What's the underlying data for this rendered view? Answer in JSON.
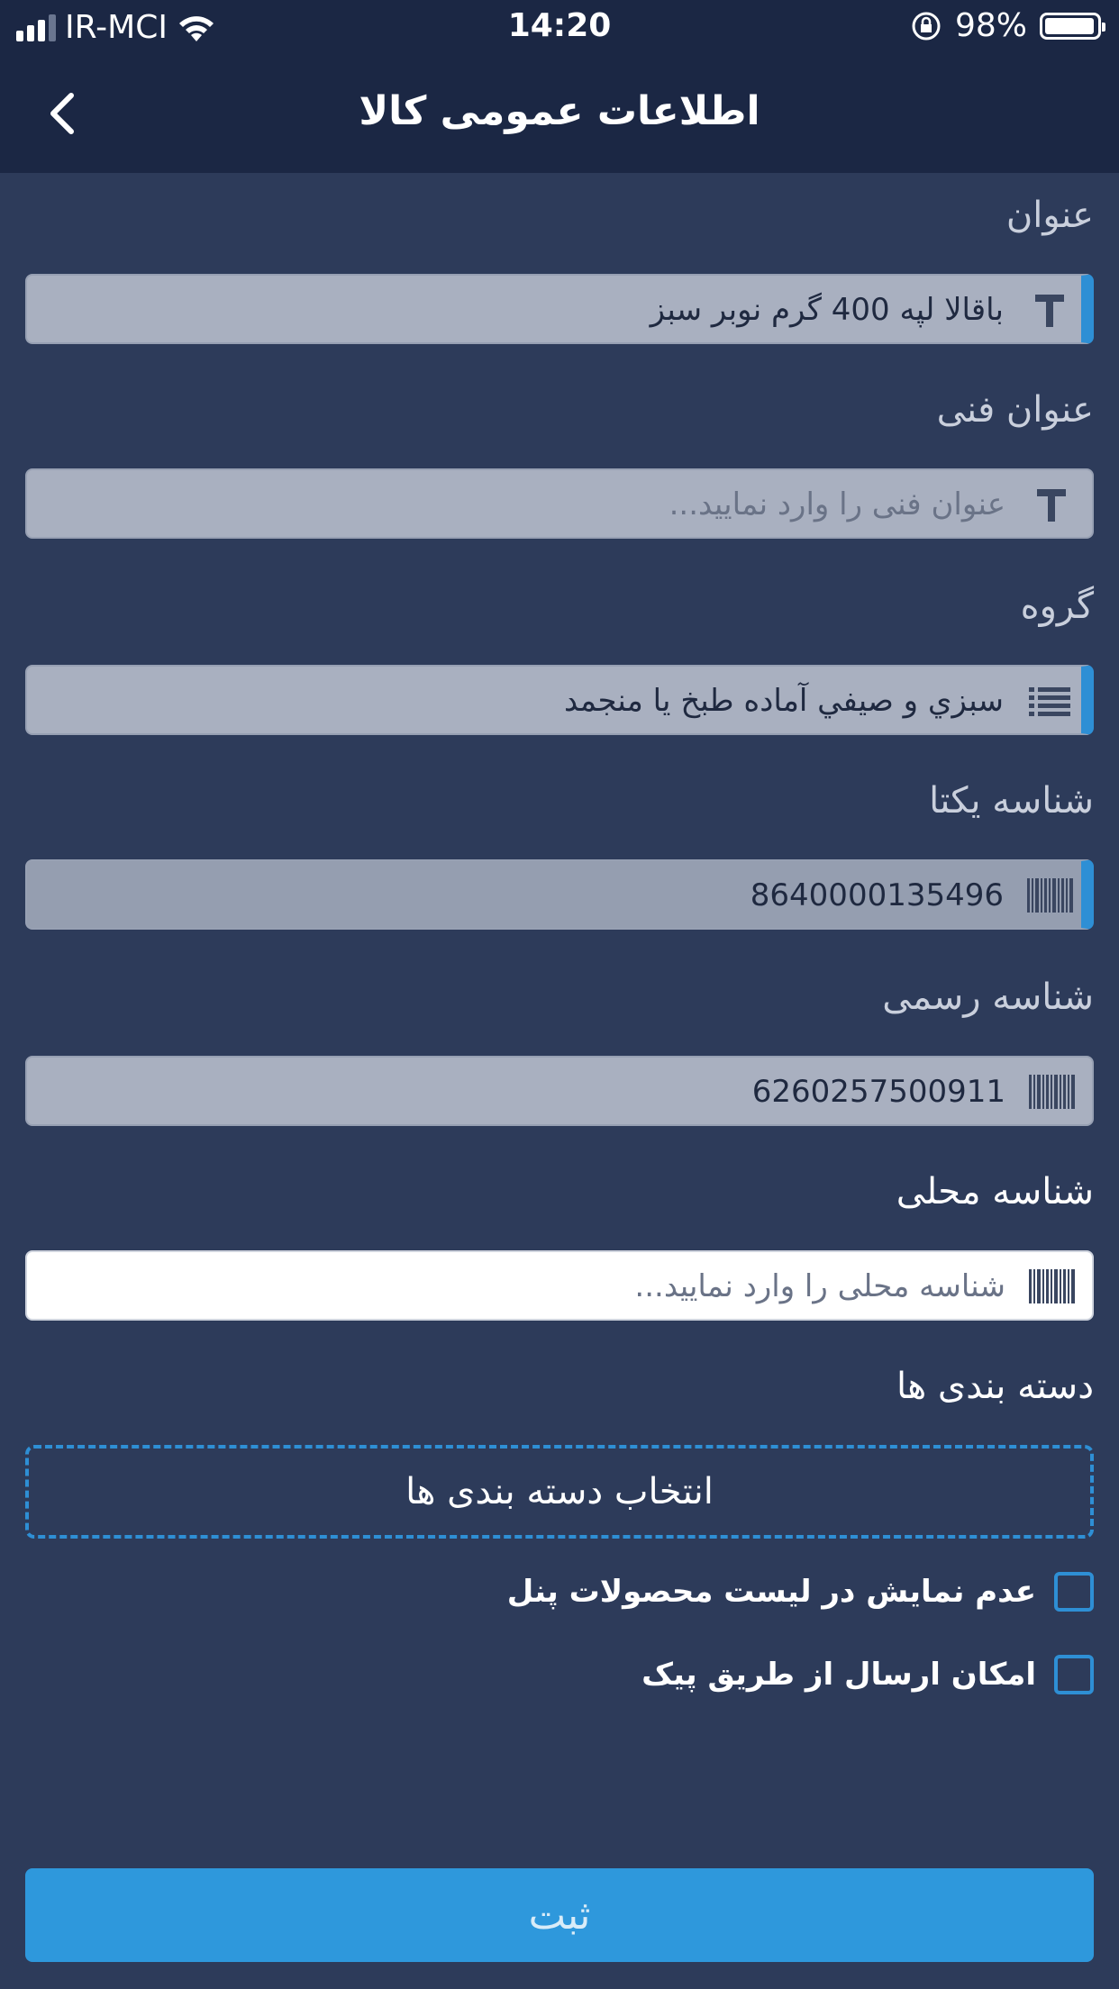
{
  "status_bar": {
    "carrier": "IR-MCI",
    "time": "14:20",
    "battery": "98%",
    "battery_level": 0.98
  },
  "nav": {
    "title": "اطلاعات عمومی کالا",
    "back_icon": "chevron-left-icon"
  },
  "fields": {
    "title": {
      "label": "عنوان",
      "value": "باقالا لپه 400 گرم نوبر سبز",
      "icon": "text-icon"
    },
    "technical_title": {
      "label": "عنوان فنی",
      "placeholder": "عنوان فنی را وارد نمایید...",
      "icon": "text-icon"
    },
    "group": {
      "label": "گروه",
      "value": "سبزي و صيفي آماده طبخ يا منجمد",
      "icon": "list-icon"
    },
    "unique_id": {
      "label": "شناسه یکتا",
      "value": "8640000135496",
      "icon": "barcode-icon"
    },
    "official_id": {
      "label": "شناسه رسمی",
      "value": "6260257500911",
      "icon": "barcode-icon"
    },
    "local_id": {
      "label": "شناسه محلی",
      "placeholder": "شناسه محلی را وارد نمایید...",
      "icon": "barcode-icon"
    }
  },
  "categories": {
    "label": "دسته بندی ها",
    "button": "انتخاب دسته بندی ها"
  },
  "checkboxes": [
    {
      "label": "عدم نمایش در لیست محصولات پنل",
      "checked": false
    },
    {
      "label": "امکان ارسال از طریق پیک",
      "checked": false
    }
  ],
  "submit_label": "ثبت",
  "colors": {
    "background": "#2d3b5a",
    "header": "#1b2744",
    "accent": "#2e8fd5",
    "field": "#a9b0c0"
  }
}
